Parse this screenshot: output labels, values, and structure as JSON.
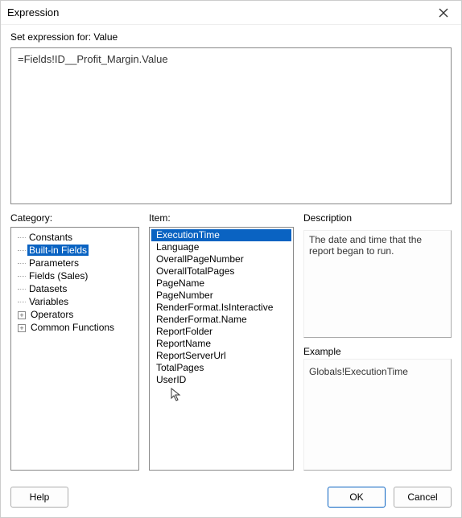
{
  "window": {
    "title": "Expression"
  },
  "subLabel": "Set expression for: Value",
  "expression": "=Fields!ID__Profit_Margin.Value",
  "labels": {
    "category": "Category:",
    "item": "Item:",
    "description": "Description",
    "example": "Example"
  },
  "categories": {
    "toggle_plus": "+",
    "items": [
      {
        "label": "Constants",
        "expandable": false
      },
      {
        "label": "Built-in Fields",
        "expandable": false,
        "selected": true
      },
      {
        "label": "Parameters",
        "expandable": false
      },
      {
        "label": "Fields (Sales)",
        "expandable": false
      },
      {
        "label": "Datasets",
        "expandable": false
      },
      {
        "label": "Variables",
        "expandable": false
      },
      {
        "label": "Operators",
        "expandable": true
      },
      {
        "label": "Common Functions",
        "expandable": true
      }
    ]
  },
  "items": [
    {
      "label": "ExecutionTime",
      "selected": true
    },
    {
      "label": "Language"
    },
    {
      "label": "OverallPageNumber"
    },
    {
      "label": "OverallTotalPages"
    },
    {
      "label": "PageName"
    },
    {
      "label": "PageNumber"
    },
    {
      "label": "RenderFormat.IsInteractive"
    },
    {
      "label": "RenderFormat.Name"
    },
    {
      "label": "ReportFolder"
    },
    {
      "label": "ReportName"
    },
    {
      "label": "ReportServerUrl"
    },
    {
      "label": "TotalPages"
    },
    {
      "label": "UserID"
    }
  ],
  "descriptionText": "The date and time that the report began to run.",
  "exampleText": "Globals!ExecutionTime",
  "buttons": {
    "help": "Help",
    "ok": "OK",
    "cancel": "Cancel"
  }
}
